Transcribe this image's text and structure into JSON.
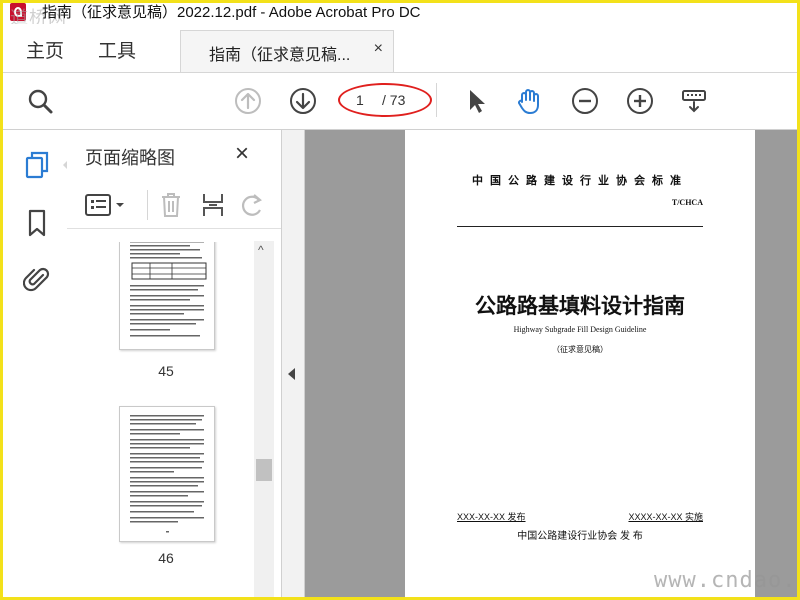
{
  "window": {
    "title": "指南（征求意见稿）2022.12.pdf - Adobe Acrobat Pro DC",
    "watermark_top_left": "道桥网"
  },
  "tabs": {
    "home": "主页",
    "tools": "工具",
    "document": "指南（征求意见稿...",
    "close": "×"
  },
  "toolbar": {
    "page_current": "1",
    "page_total": "/ 73",
    "icons": [
      "search-icon",
      "previous-page-icon",
      "next-page-icon",
      "select-cursor-icon",
      "hand-tool-icon",
      "zoom-out-icon",
      "zoom-in-icon",
      "keyboard-icon"
    ],
    "highlight_color": "#e0201e",
    "accent_color": "#2b7cd3"
  },
  "sidebar": {
    "icons": [
      "pages-icon",
      "bookmark-icon",
      "attachment-icon"
    ]
  },
  "thumbnails_panel": {
    "title": "页面缩略图",
    "close": "×",
    "tool_icons": [
      "options-icon",
      "delete-icon",
      "extract-icon",
      "rotate-icon"
    ],
    "pages": [
      {
        "number": "45"
      },
      {
        "number": "46"
      }
    ]
  },
  "document_page": {
    "organization_header": "中国公路建设行业协会标准",
    "code": "T/CHCA",
    "title": "公路路基填料设计指南",
    "subtitle_en": "Highway Subgrade Fill Design Guideline",
    "draft_note": "（征求意见稿）",
    "release_date": "XXX-XX-XX 发布",
    "implementation_date": "XXXX-XX-XX 实施",
    "publisher": "中国公路建设行业协会  发 布"
  },
  "watermark_bottom_right": "www.cndao."
}
